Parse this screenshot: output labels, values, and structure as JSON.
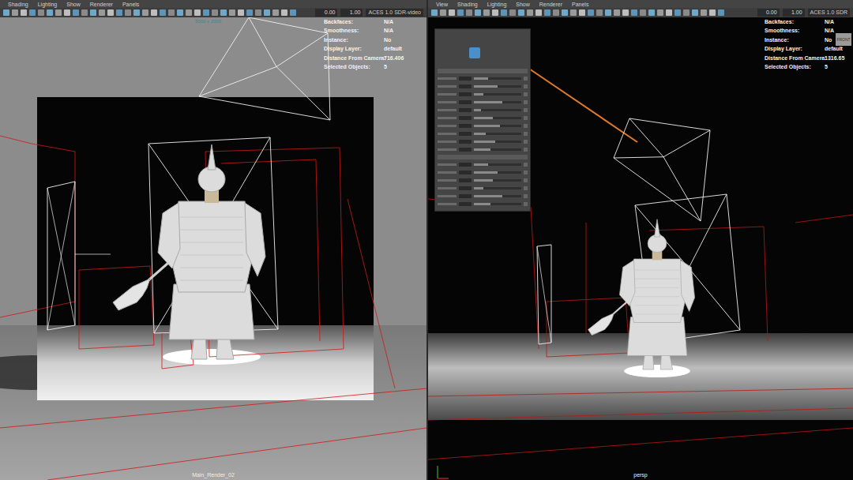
{
  "panels": [
    {
      "kind": "render",
      "menu": [
        "Shading",
        "Lighting",
        "Show",
        "Renderer",
        "Panels"
      ],
      "toolbar": {
        "exposure": "0.00",
        "gamma": "1.00",
        "color_space": "ACES 1.0 SDR-video"
      },
      "gate_label": "5000 x 2000",
      "hud": [
        {
          "label": "Backfaces:",
          "value": "N/A"
        },
        {
          "label": "Smoothness:",
          "value": "N/A"
        },
        {
          "label": "Instance:",
          "value": "No"
        },
        {
          "label": "Display Layer:",
          "value": "default"
        },
        {
          "label": "Distance From Camera:",
          "value": "716.406"
        },
        {
          "label": "Selected Objects:",
          "value": "5"
        }
      ],
      "camera": "Main_Render_02"
    },
    {
      "kind": "persp",
      "menu": [
        "View",
        "Shading",
        "Lighting",
        "Show",
        "Renderer",
        "Panels"
      ],
      "toolbar": {
        "exposure": "0.00",
        "gamma": "1.00",
        "color_space": "ACES 1.0 SDR"
      },
      "view_cube": "FRONT",
      "hud": [
        {
          "label": "Backfaces:",
          "value": "N/A"
        },
        {
          "label": "Smoothness:",
          "value": "N/A"
        },
        {
          "label": "Instance:",
          "value": "No"
        },
        {
          "label": "Display Layer:",
          "value": "default"
        },
        {
          "label": "Distance From Camera:",
          "value": "1316.65"
        },
        {
          "label": "Selected Objects:",
          "value": "5"
        }
      ],
      "camera": "persp",
      "attribute_editor": {
        "sliders": [
          {
            "level": 0.3
          },
          {
            "level": 0.5
          },
          {
            "level": 0.2
          },
          {
            "level": 0.6
          },
          {
            "level": 0.15
          },
          {
            "level": 0.4
          },
          {
            "level": 0.55
          },
          {
            "level": 0.25
          },
          {
            "level": 0.45
          },
          {
            "level": 0.35
          },
          {
            "level": 0.3
          },
          {
            "level": 0.5
          },
          {
            "level": 0.4
          },
          {
            "level": 0.2
          },
          {
            "level": 0.6
          },
          {
            "level": 0.35
          }
        ]
      }
    }
  ]
}
